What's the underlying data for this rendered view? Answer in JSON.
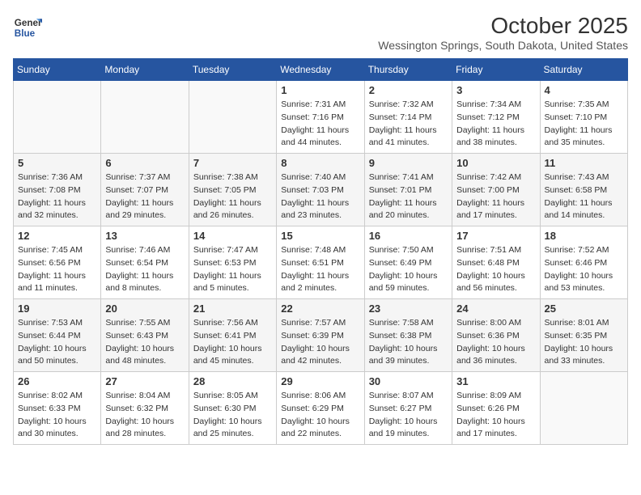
{
  "header": {
    "logo": {
      "line1": "General",
      "line2": "Blue"
    },
    "month": "October 2025",
    "location": "Wessington Springs, South Dakota, United States"
  },
  "weekdays": [
    "Sunday",
    "Monday",
    "Tuesday",
    "Wednesday",
    "Thursday",
    "Friday",
    "Saturday"
  ],
  "weeks": [
    [
      {
        "day": "",
        "sunrise": "",
        "sunset": "",
        "daylight": ""
      },
      {
        "day": "",
        "sunrise": "",
        "sunset": "",
        "daylight": ""
      },
      {
        "day": "",
        "sunrise": "",
        "sunset": "",
        "daylight": ""
      },
      {
        "day": "1",
        "sunrise": "Sunrise: 7:31 AM",
        "sunset": "Sunset: 7:16 PM",
        "daylight": "Daylight: 11 hours and 44 minutes."
      },
      {
        "day": "2",
        "sunrise": "Sunrise: 7:32 AM",
        "sunset": "Sunset: 7:14 PM",
        "daylight": "Daylight: 11 hours and 41 minutes."
      },
      {
        "day": "3",
        "sunrise": "Sunrise: 7:34 AM",
        "sunset": "Sunset: 7:12 PM",
        "daylight": "Daylight: 11 hours and 38 minutes."
      },
      {
        "day": "4",
        "sunrise": "Sunrise: 7:35 AM",
        "sunset": "Sunset: 7:10 PM",
        "daylight": "Daylight: 11 hours and 35 minutes."
      }
    ],
    [
      {
        "day": "5",
        "sunrise": "Sunrise: 7:36 AM",
        "sunset": "Sunset: 7:08 PM",
        "daylight": "Daylight: 11 hours and 32 minutes."
      },
      {
        "day": "6",
        "sunrise": "Sunrise: 7:37 AM",
        "sunset": "Sunset: 7:07 PM",
        "daylight": "Daylight: 11 hours and 29 minutes."
      },
      {
        "day": "7",
        "sunrise": "Sunrise: 7:38 AM",
        "sunset": "Sunset: 7:05 PM",
        "daylight": "Daylight: 11 hours and 26 minutes."
      },
      {
        "day": "8",
        "sunrise": "Sunrise: 7:40 AM",
        "sunset": "Sunset: 7:03 PM",
        "daylight": "Daylight: 11 hours and 23 minutes."
      },
      {
        "day": "9",
        "sunrise": "Sunrise: 7:41 AM",
        "sunset": "Sunset: 7:01 PM",
        "daylight": "Daylight: 11 hours and 20 minutes."
      },
      {
        "day": "10",
        "sunrise": "Sunrise: 7:42 AM",
        "sunset": "Sunset: 7:00 PM",
        "daylight": "Daylight: 11 hours and 17 minutes."
      },
      {
        "day": "11",
        "sunrise": "Sunrise: 7:43 AM",
        "sunset": "Sunset: 6:58 PM",
        "daylight": "Daylight: 11 hours and 14 minutes."
      }
    ],
    [
      {
        "day": "12",
        "sunrise": "Sunrise: 7:45 AM",
        "sunset": "Sunset: 6:56 PM",
        "daylight": "Daylight: 11 hours and 11 minutes."
      },
      {
        "day": "13",
        "sunrise": "Sunrise: 7:46 AM",
        "sunset": "Sunset: 6:54 PM",
        "daylight": "Daylight: 11 hours and 8 minutes."
      },
      {
        "day": "14",
        "sunrise": "Sunrise: 7:47 AM",
        "sunset": "Sunset: 6:53 PM",
        "daylight": "Daylight: 11 hours and 5 minutes."
      },
      {
        "day": "15",
        "sunrise": "Sunrise: 7:48 AM",
        "sunset": "Sunset: 6:51 PM",
        "daylight": "Daylight: 11 hours and 2 minutes."
      },
      {
        "day": "16",
        "sunrise": "Sunrise: 7:50 AM",
        "sunset": "Sunset: 6:49 PM",
        "daylight": "Daylight: 10 hours and 59 minutes."
      },
      {
        "day": "17",
        "sunrise": "Sunrise: 7:51 AM",
        "sunset": "Sunset: 6:48 PM",
        "daylight": "Daylight: 10 hours and 56 minutes."
      },
      {
        "day": "18",
        "sunrise": "Sunrise: 7:52 AM",
        "sunset": "Sunset: 6:46 PM",
        "daylight": "Daylight: 10 hours and 53 minutes."
      }
    ],
    [
      {
        "day": "19",
        "sunrise": "Sunrise: 7:53 AM",
        "sunset": "Sunset: 6:44 PM",
        "daylight": "Daylight: 10 hours and 50 minutes."
      },
      {
        "day": "20",
        "sunrise": "Sunrise: 7:55 AM",
        "sunset": "Sunset: 6:43 PM",
        "daylight": "Daylight: 10 hours and 48 minutes."
      },
      {
        "day": "21",
        "sunrise": "Sunrise: 7:56 AM",
        "sunset": "Sunset: 6:41 PM",
        "daylight": "Daylight: 10 hours and 45 minutes."
      },
      {
        "day": "22",
        "sunrise": "Sunrise: 7:57 AM",
        "sunset": "Sunset: 6:39 PM",
        "daylight": "Daylight: 10 hours and 42 minutes."
      },
      {
        "day": "23",
        "sunrise": "Sunrise: 7:58 AM",
        "sunset": "Sunset: 6:38 PM",
        "daylight": "Daylight: 10 hours and 39 minutes."
      },
      {
        "day": "24",
        "sunrise": "Sunrise: 8:00 AM",
        "sunset": "Sunset: 6:36 PM",
        "daylight": "Daylight: 10 hours and 36 minutes."
      },
      {
        "day": "25",
        "sunrise": "Sunrise: 8:01 AM",
        "sunset": "Sunset: 6:35 PM",
        "daylight": "Daylight: 10 hours and 33 minutes."
      }
    ],
    [
      {
        "day": "26",
        "sunrise": "Sunrise: 8:02 AM",
        "sunset": "Sunset: 6:33 PM",
        "daylight": "Daylight: 10 hours and 30 minutes."
      },
      {
        "day": "27",
        "sunrise": "Sunrise: 8:04 AM",
        "sunset": "Sunset: 6:32 PM",
        "daylight": "Daylight: 10 hours and 28 minutes."
      },
      {
        "day": "28",
        "sunrise": "Sunrise: 8:05 AM",
        "sunset": "Sunset: 6:30 PM",
        "daylight": "Daylight: 10 hours and 25 minutes."
      },
      {
        "day": "29",
        "sunrise": "Sunrise: 8:06 AM",
        "sunset": "Sunset: 6:29 PM",
        "daylight": "Daylight: 10 hours and 22 minutes."
      },
      {
        "day": "30",
        "sunrise": "Sunrise: 8:07 AM",
        "sunset": "Sunset: 6:27 PM",
        "daylight": "Daylight: 10 hours and 19 minutes."
      },
      {
        "day": "31",
        "sunrise": "Sunrise: 8:09 AM",
        "sunset": "Sunset: 6:26 PM",
        "daylight": "Daylight: 10 hours and 17 minutes."
      },
      {
        "day": "",
        "sunrise": "",
        "sunset": "",
        "daylight": ""
      }
    ]
  ]
}
